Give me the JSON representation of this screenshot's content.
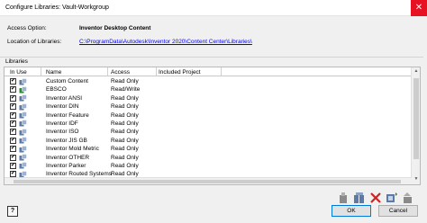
{
  "window": {
    "title": "Configure Libraries: Vault-Workgroup",
    "close_glyph": "✕"
  },
  "info": {
    "access_option_label": "Access Option:",
    "access_option_value": "Inventor Desktop Content",
    "location_label": "Location of Libraries:",
    "location_value": "C:\\ProgramData\\Autodesk\\Inventor 2020\\Content Center\\Libraries\\"
  },
  "libraries": {
    "section_label": "Libraries",
    "columns": {
      "in_use": "In Use",
      "name": "Name",
      "access": "Access",
      "included_project": "Included Project"
    },
    "rows": [
      {
        "checked": true,
        "icon": "library-readonly-icon",
        "name": "Custom Content",
        "access": "Read Only"
      },
      {
        "checked": true,
        "icon": "library-readwrite-icon",
        "name": "EBSCO",
        "access": "Read/Write"
      },
      {
        "checked": true,
        "icon": "library-readonly-icon",
        "name": "Inventor ANSI",
        "access": "Read Only"
      },
      {
        "checked": true,
        "icon": "library-readonly-icon",
        "name": "Inventor DIN",
        "access": "Read Only"
      },
      {
        "checked": true,
        "icon": "library-readonly-icon",
        "name": "Inventor Feature",
        "access": "Read Only"
      },
      {
        "checked": true,
        "icon": "library-readonly-icon",
        "name": "Inventor IDF",
        "access": "Read Only"
      },
      {
        "checked": true,
        "icon": "library-readonly-icon",
        "name": "Inventor ISO",
        "access": "Read Only"
      },
      {
        "checked": true,
        "icon": "library-readonly-icon",
        "name": "Inventor JIS GB",
        "access": "Read Only"
      },
      {
        "checked": true,
        "icon": "library-readonly-icon",
        "name": "Inventor Mold Metric",
        "access": "Read Only"
      },
      {
        "checked": true,
        "icon": "library-readonly-icon",
        "name": "Inventor OTHER",
        "access": "Read Only"
      },
      {
        "checked": true,
        "icon": "library-readonly-icon",
        "name": "Inventor Parker",
        "access": "Read Only"
      },
      {
        "checked": true,
        "icon": "library-readonly-icon",
        "name": "Inventor Routed Systems",
        "access": "Read Only"
      }
    ]
  },
  "buttons": {
    "help": "?",
    "ok": "OK",
    "cancel": "Cancel"
  },
  "toolbar_icons": [
    "import-library-icon",
    "create-library-icon",
    "remove-library-icon",
    "update-library-icon",
    "upgrade-library-icon"
  ],
  "colors": {
    "link": "#0000ee",
    "readonly_icon": "#5a7aa8",
    "readwrite_icon": "#2a8a3a",
    "close": "#e81123"
  }
}
